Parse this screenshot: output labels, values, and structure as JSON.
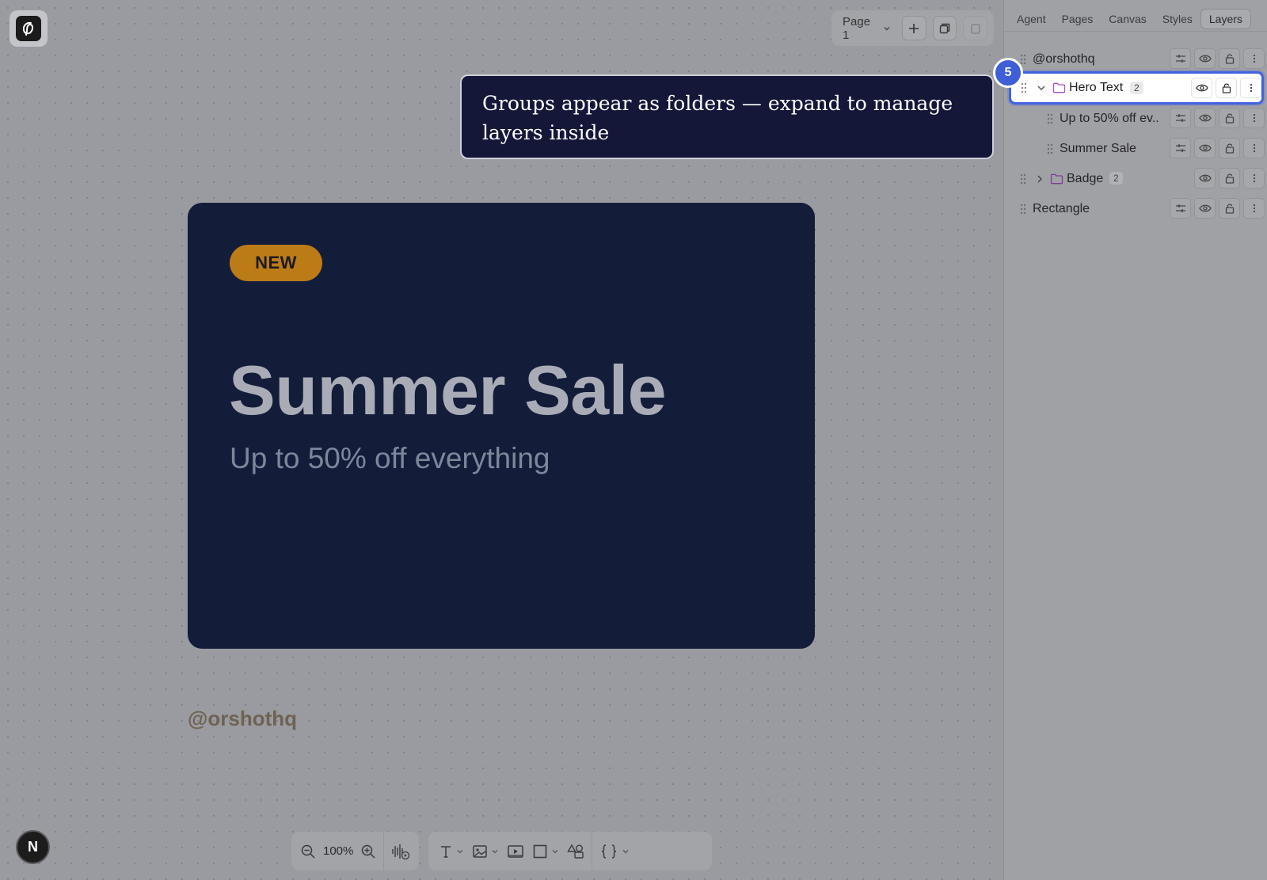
{
  "canvas": {
    "page_selector": "Page 1",
    "card": {
      "badge": "NEW",
      "title": "Summer Sale",
      "subtitle": "Up to 50% off everything"
    },
    "handle": "@orshothq",
    "avatar_letter": "N",
    "zoom": "100%"
  },
  "tooltip": {
    "step": "5",
    "text": "Groups appear as folders — expand to manage layers inside"
  },
  "panel": {
    "tabs": [
      "Agent",
      "Pages",
      "Canvas",
      "Styles",
      "Layers"
    ],
    "active_tab": "Layers",
    "layers": [
      {
        "label": "@orshothq",
        "type": "text"
      },
      {
        "label": "Hero Text",
        "type": "group",
        "count": "2",
        "expanded": true,
        "selected": true
      },
      {
        "label": "Up to 50% off ev...",
        "type": "text",
        "child": true
      },
      {
        "label": "Summer Sale",
        "type": "text",
        "child": true
      },
      {
        "label": "Badge",
        "type": "group",
        "count": "2",
        "expanded": false
      },
      {
        "label": "Rectangle",
        "type": "shape"
      }
    ]
  },
  "colors": {
    "card_bg": "#131d3a",
    "badge_bg": "#bb7c18",
    "tooltip_bg": "#141738",
    "selection_accent": "#4262e0",
    "folder_icon": "#a44fc9"
  }
}
